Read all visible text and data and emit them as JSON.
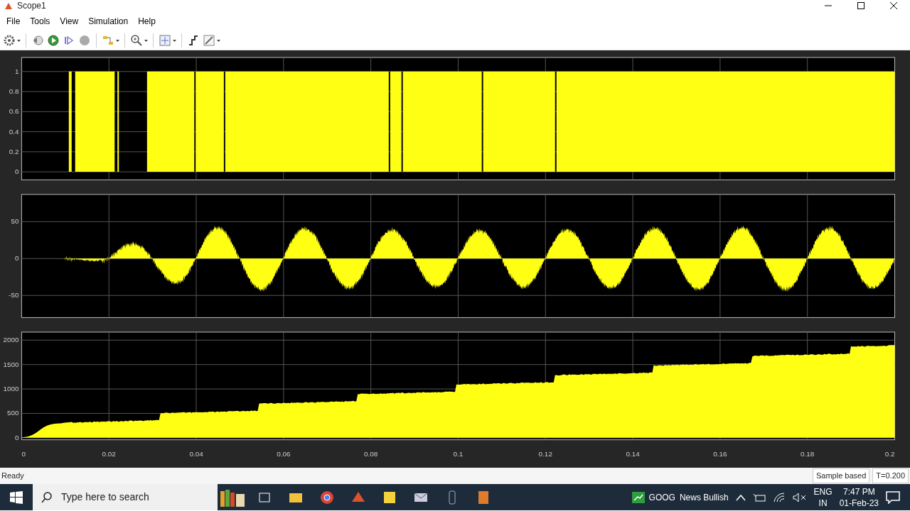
{
  "window": {
    "title": "Scope1"
  },
  "menu": [
    "File",
    "Tools",
    "View",
    "Simulation",
    "Help"
  ],
  "plots": [
    {
      "yticks": [
        "1",
        "0.8",
        "0.6",
        "0.4",
        "0.2",
        "0"
      ],
      "kind": "pulse"
    },
    {
      "yticks": [
        "50",
        "0",
        "-50"
      ],
      "kind": "sine"
    },
    {
      "yticks": [
        "2000",
        "1500",
        "1000",
        "500",
        "0"
      ],
      "kind": "ramp"
    }
  ],
  "xticks": [
    "0",
    "0.02",
    "0.04",
    "0.06",
    "0.08",
    "0.1",
    "0.12",
    "0.14",
    "0.16",
    "0.18",
    "0.2"
  ],
  "status_bar": {
    "text": "Ready",
    "mode": "Sample based",
    "time": "T=0.200"
  },
  "taskbar": {
    "search": {
      "placeholder": "Type here to search"
    },
    "news": "GOOG",
    "news_headline": "News Bullish",
    "language": "ENG",
    "region": "IN",
    "time": "7:47 PM",
    "date": "01-Feb-23"
  }
}
